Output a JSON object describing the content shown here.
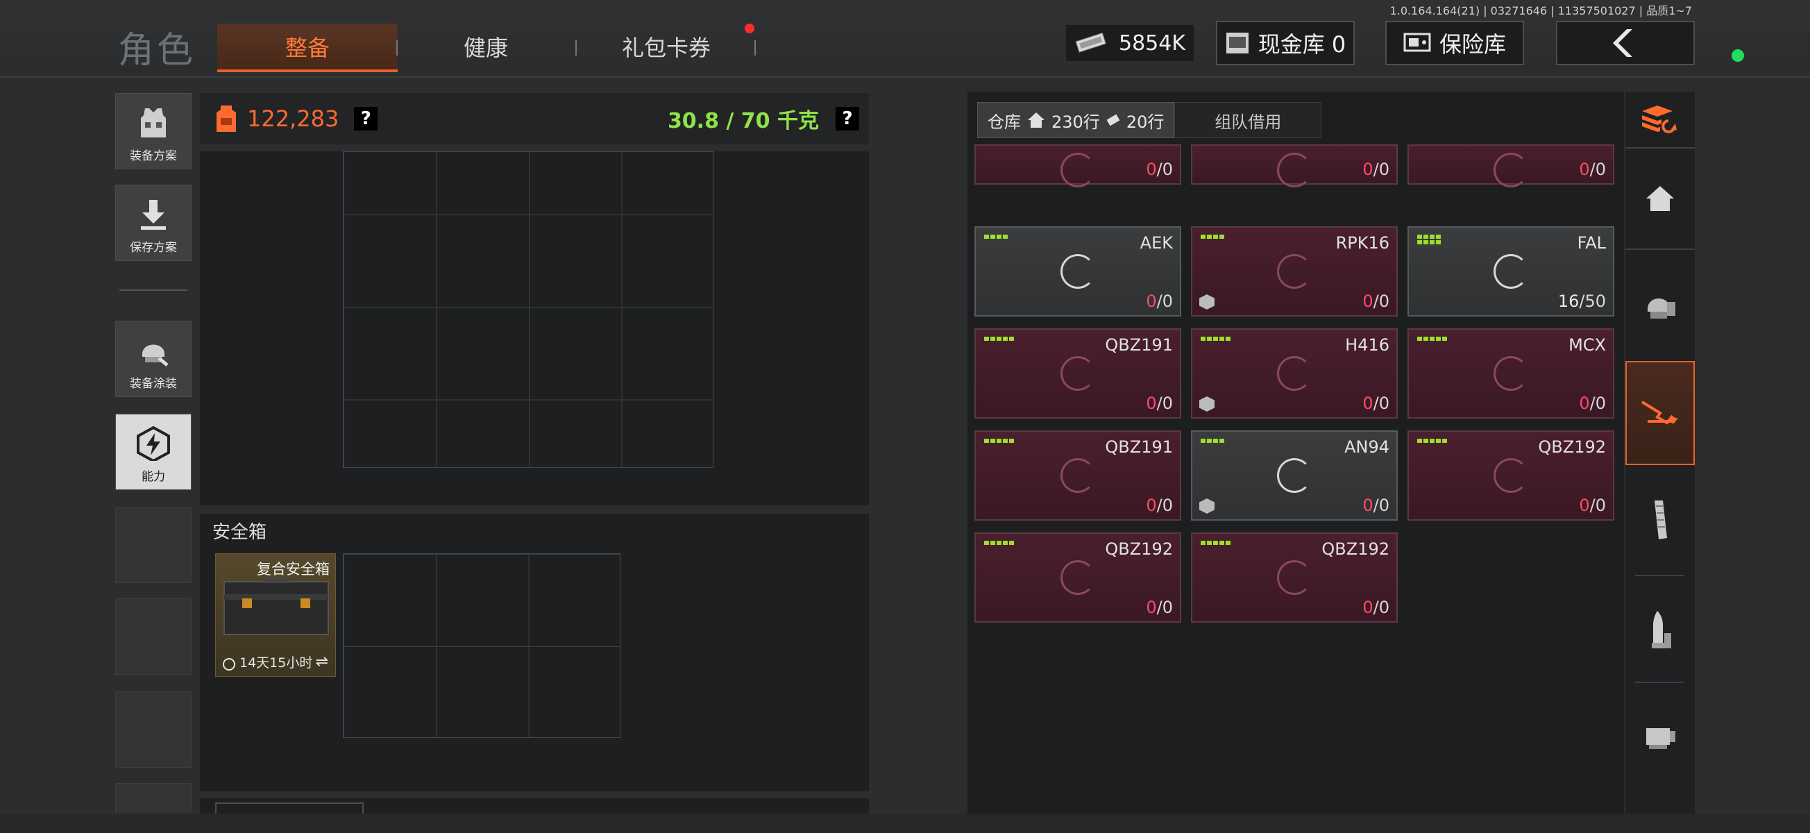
{
  "build_info": "1.0.164.164(21) | 03271646 | 11357501027 | 品质1~7",
  "header": {
    "title": "角色",
    "tabs": [
      {
        "label": "整备",
        "active": true
      },
      {
        "label": "健康",
        "active": false
      },
      {
        "label": "礼包卡券",
        "active": false,
        "badge": true
      }
    ],
    "money": "5854K",
    "cash_vault": "现金库 0",
    "safe_vault": "保险库",
    "colors": {
      "accent": "#e8602c",
      "online": "#1fdc5a",
      "badge": "#ff2a2a"
    }
  },
  "sidebar": {
    "items": [
      {
        "label": "装备方案",
        "icon": "vest-icon"
      },
      {
        "label": "保存方案",
        "icon": "download-arrow-icon"
      },
      {
        "label": "装备涂装",
        "icon": "helmet-paint-icon"
      },
      {
        "label": "能力",
        "icon": "bolt-hexagon-icon",
        "selected": true
      }
    ]
  },
  "bag": {
    "value": "122,283",
    "help": "?",
    "weight": "30.8 / 70 千克",
    "help2": "?"
  },
  "safe": {
    "title": "安全箱",
    "box_name": "复合安全箱",
    "duration": "14天15小时",
    "swap_icon": "⇌"
  },
  "storage": {
    "tab_label": "仓库",
    "rows": "230行",
    "items": "20行",
    "team_tab": "组队借用",
    "cards": [
      {
        "name": "",
        "count": "0",
        "capacity": "/0",
        "style": "red"
      },
      {
        "name": "",
        "count": "0",
        "capacity": "/0",
        "style": "red"
      },
      {
        "name": "",
        "count": "0",
        "capacity": "/0",
        "style": "red"
      },
      {
        "name": "AEK",
        "count": "0",
        "capacity": "/0",
        "style": "grey",
        "bars": 4
      },
      {
        "name": "RPK16",
        "count": "0",
        "capacity": "/0",
        "style": "red",
        "bars": 4,
        "box": true
      },
      {
        "name": "FAL",
        "count": "16",
        "capacity": "/50",
        "style": "grey",
        "bars": 8,
        "white": true
      },
      {
        "name": "QBZ191",
        "count": "0",
        "capacity": "/0",
        "style": "red",
        "bars": 5
      },
      {
        "name": "H416",
        "count": "0",
        "capacity": "/0",
        "style": "red",
        "bars": 5,
        "box": true
      },
      {
        "name": "MCX",
        "count": "0",
        "capacity": "/0",
        "style": "red",
        "bars": 5
      },
      {
        "name": "QBZ191",
        "count": "0",
        "capacity": "/0",
        "style": "red",
        "bars": 5
      },
      {
        "name": "AN94",
        "count": "0",
        "capacity": "/0",
        "style": "grey",
        "bars": 4,
        "box": true
      },
      {
        "name": "QBZ192",
        "count": "0",
        "capacity": "/0",
        "style": "red",
        "bars": 5
      },
      {
        "name": "QBZ192",
        "count": "0",
        "capacity": "/0",
        "style": "red",
        "bars": 5
      },
      {
        "name": "QBZ192",
        "count": "0",
        "capacity": "/0",
        "style": "red",
        "bars": 5
      }
    ]
  },
  "categories": [
    {
      "icon": "stack-refresh-icon"
    },
    {
      "icon": "home-icon"
    },
    {
      "icon": "armor-icon"
    },
    {
      "icon": "rifle-icon",
      "active": true
    },
    {
      "icon": "magazine-icon"
    },
    {
      "icon": "ammo-icon"
    },
    {
      "icon": "scope-icon"
    }
  ]
}
